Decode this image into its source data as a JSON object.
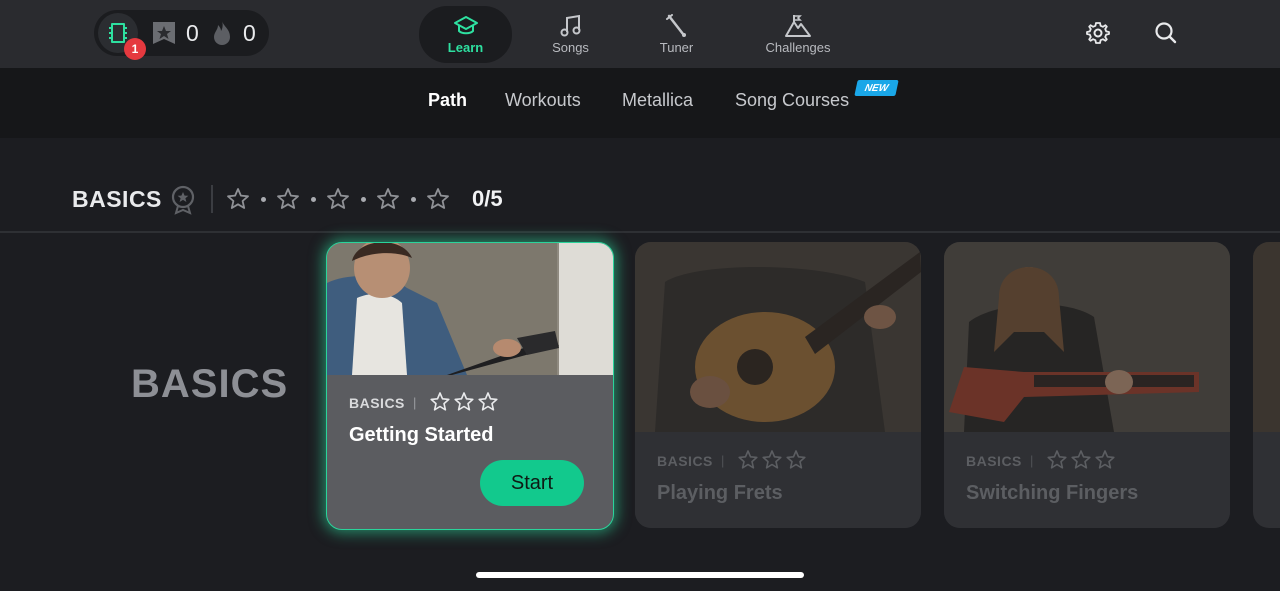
{
  "header": {
    "notification_count": "1",
    "stars": "0",
    "streak": "0",
    "tabs": [
      {
        "label": "Learn",
        "icon": "graduation-cap-icon",
        "active": true
      },
      {
        "label": "Songs",
        "icon": "music-note-icon",
        "active": false
      },
      {
        "label": "Tuner",
        "icon": "tuner-icon",
        "active": false
      },
      {
        "label": "Challenges",
        "icon": "challenges-icon",
        "active": false
      }
    ],
    "settings_icon": "gear-icon",
    "search_icon": "search-icon"
  },
  "subnav": {
    "items": [
      {
        "label": "Path",
        "active": true
      },
      {
        "label": "Workouts",
        "active": false
      },
      {
        "label": "Metallica",
        "active": false
      },
      {
        "label": "Song Courses",
        "active": false
      }
    ],
    "new_badge": "NEW"
  },
  "progress": {
    "section_title": "BASICS",
    "count": "0/5",
    "stars_earned": 0,
    "stars_total": 5
  },
  "section_label": "BASICS",
  "cards": [
    {
      "category": "BASICS",
      "title": "Getting Started",
      "button": "Start",
      "active": true
    },
    {
      "category": "BASICS",
      "title": "Playing Frets",
      "active": false
    },
    {
      "category": "BASICS",
      "title": "Switching Fingers",
      "active": false
    }
  ],
  "colors": {
    "accent": "#2ee0a0",
    "button": "#12c98d",
    "badge_red": "#e5393f",
    "new_blue": "#1aa7e8",
    "background": "#1c1d21"
  }
}
